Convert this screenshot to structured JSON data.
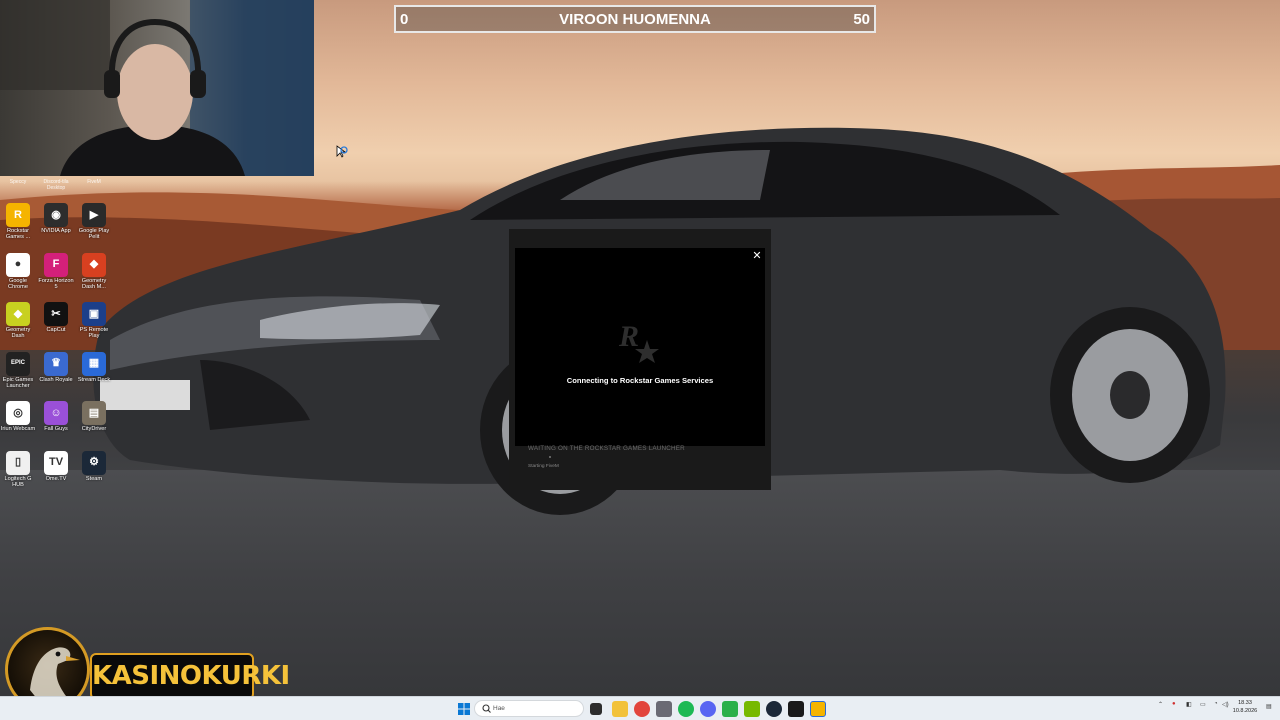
{
  "scoreboard": {
    "left_value": "0",
    "title": "VIROON HUOMENNA",
    "right_value": "50"
  },
  "desktop": {
    "top_strip": [
      "Speccy",
      "Discord-tila Desktop",
      "FiveM"
    ],
    "icons": [
      {
        "label": "Rockstar Games ...",
        "icon": "rockstar-icon",
        "color": "#f5b400",
        "glyph": "R"
      },
      {
        "label": "NVIDIA App",
        "icon": "nvidia-icon",
        "color": "#2d2d2d",
        "glyph": "◉"
      },
      {
        "label": "Google Play Pelit",
        "icon": "google-play-games-icon",
        "color": "#2a2a2a",
        "glyph": "▶"
      },
      {
        "label": "Google Chrome",
        "icon": "chrome-icon",
        "color": "#ffffff",
        "glyph": "●"
      },
      {
        "label": "Forza Horizon 5",
        "icon": "forza-icon",
        "color": "#d4207a",
        "glyph": "F"
      },
      {
        "label": "Geometry Dash M...",
        "icon": "geometry-dash-meltdown-icon",
        "color": "#d84020",
        "glyph": "◆"
      },
      {
        "label": "Geometry Dash",
        "icon": "geometry-dash-icon",
        "color": "#c8d020",
        "glyph": "◆"
      },
      {
        "label": "CapCut",
        "icon": "capcut-icon",
        "color": "#111111",
        "glyph": "✂"
      },
      {
        "label": "PS Remote Play",
        "icon": "ps-remote-play-icon",
        "color": "#1c3f8a",
        "glyph": "▣"
      },
      {
        "label": "Epic Games Launcher",
        "icon": "epic-games-icon",
        "color": "#222222",
        "glyph": "EPIC"
      },
      {
        "label": "Clash Royale",
        "icon": "clash-royale-icon",
        "color": "#3a6ad0",
        "glyph": "♛"
      },
      {
        "label": "Stream Deck",
        "icon": "stream-deck-icon",
        "color": "#2a6ad8",
        "glyph": "▦"
      },
      {
        "label": "Iriun Webcam",
        "icon": "iriun-webcam-icon",
        "color": "#ffffff",
        "glyph": "◎"
      },
      {
        "label": "Fall Guys",
        "icon": "fall-guys-icon",
        "color": "#9a50d8",
        "glyph": "☺"
      },
      {
        "label": "CityDriver",
        "icon": "citydriver-icon",
        "color": "#7a7060",
        "glyph": "▤"
      },
      {
        "label": "Logitech G HUB",
        "icon": "document-icon",
        "color": "#f0f0f0",
        "glyph": "▯"
      },
      {
        "label": "Ome.TV",
        "icon": "ometv-icon",
        "color": "#ffffff",
        "glyph": "TV"
      },
      {
        "label": "Steam",
        "icon": "steam-icon",
        "color": "#1b2838",
        "glyph": "⚙"
      }
    ]
  },
  "launcher": {
    "close_glyph": "✕",
    "status": "Connecting to Rockstar Games Services",
    "waiting_text": "WAITING ON THE ROCKSTAR GAMES LAUNCHER",
    "starting_text": "Starting FiveM"
  },
  "brand": {
    "name": "KASINOKURKI"
  },
  "taskbar": {
    "search_placeholder": "Hae",
    "clock_time": "18.33",
    "clock_date": "10.8.2026"
  }
}
